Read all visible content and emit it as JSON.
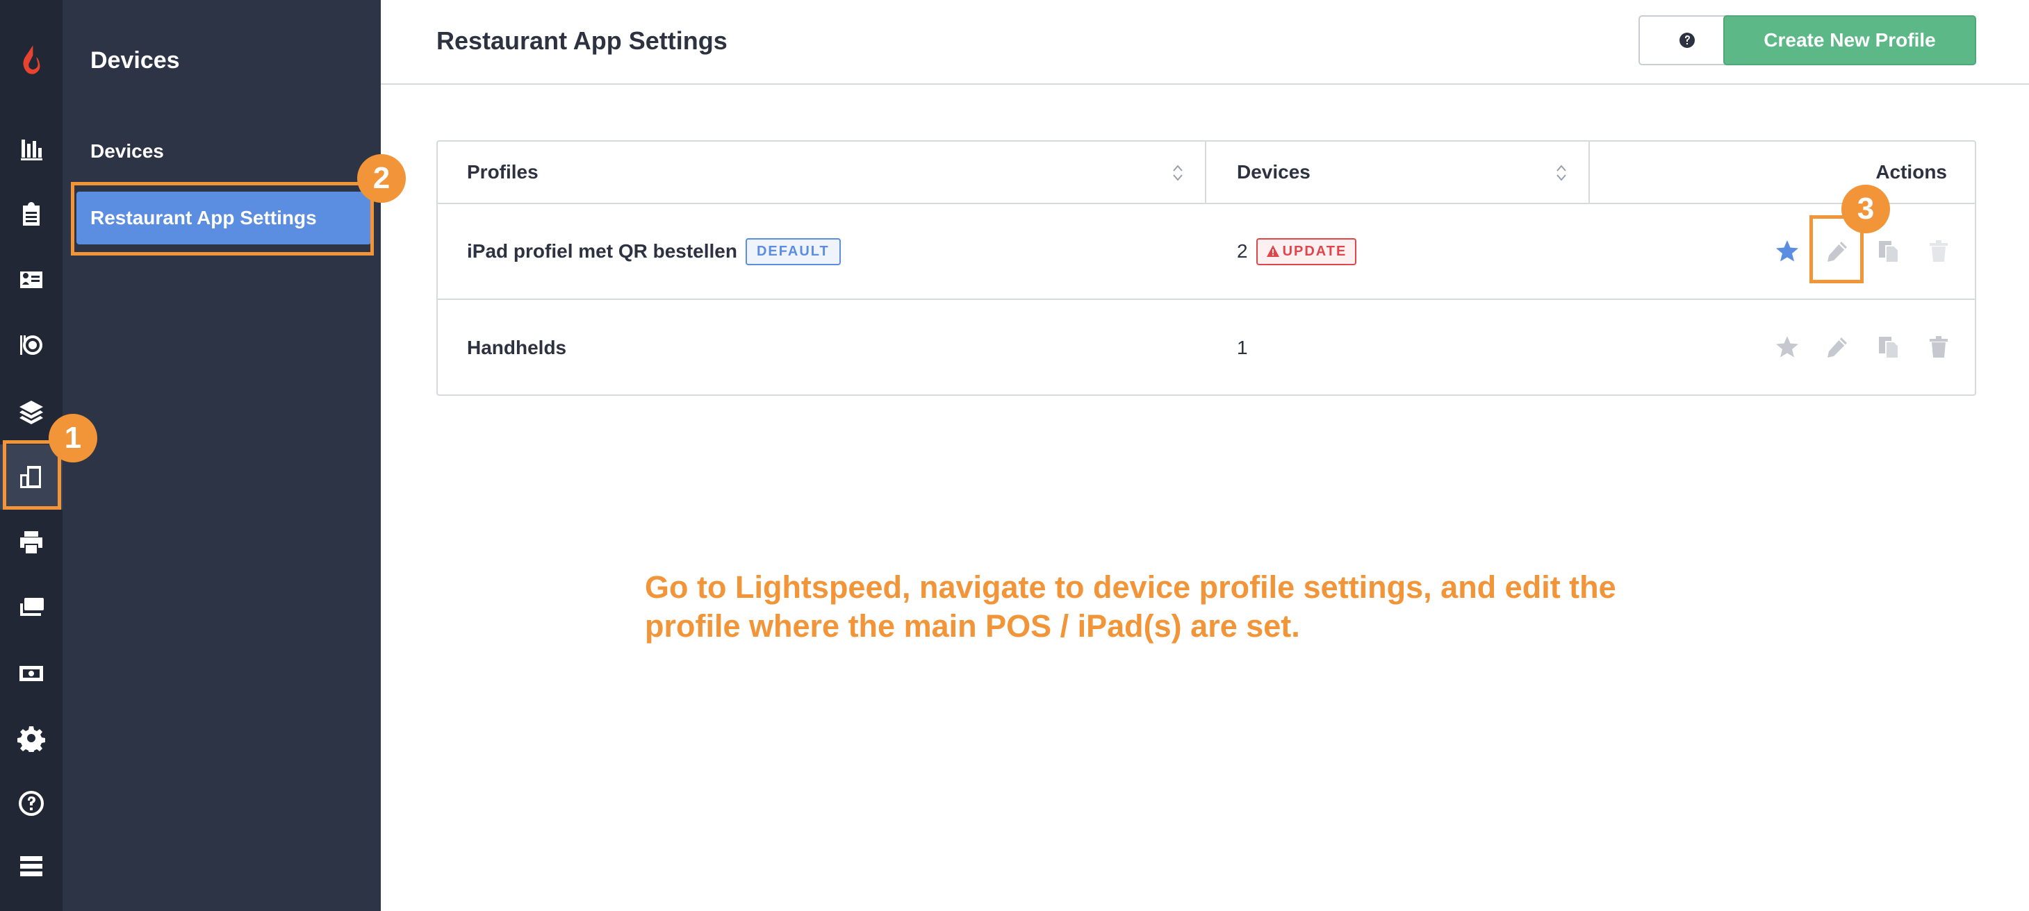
{
  "sidebar": {
    "section_title": "Devices",
    "items": [
      {
        "label": "Devices"
      },
      {
        "label": "Restaurant App Settings"
      }
    ]
  },
  "rail_icons": [
    "lightspeed-logo",
    "reports-icon",
    "clipboard-icon",
    "customer-card-icon",
    "dining-icon",
    "layers-icon",
    "devices-icon",
    "printer-icon",
    "payments-icon",
    "cash-icon",
    "gear-icon",
    "help-icon",
    "server-icon"
  ],
  "header": {
    "title": "Restaurant App Settings",
    "create_label": "Create New Profile"
  },
  "table": {
    "columns": [
      "Profiles",
      "Devices",
      "Actions"
    ],
    "rows": [
      {
        "profile": "iPad profiel met QR bestellen",
        "badge": "DEFAULT",
        "devices": "2",
        "device_badge": "UPDATE",
        "starred": true
      },
      {
        "profile": "Handhelds",
        "devices": "1",
        "starred": false
      }
    ]
  },
  "annotations": {
    "step1": "1",
    "step2": "2",
    "step3": "3",
    "instruction": "Go to Lightspeed, navigate to device profile settings, and edit the profile where the main POS / iPad(s) are set."
  },
  "colors": {
    "accent_blue": "#5b8de0",
    "create_green": "#5cb887",
    "annotation_orange": "#f29438",
    "warning_red": "#e0454c",
    "rail_bg": "#222736",
    "subnav_bg": "#2d3446"
  }
}
